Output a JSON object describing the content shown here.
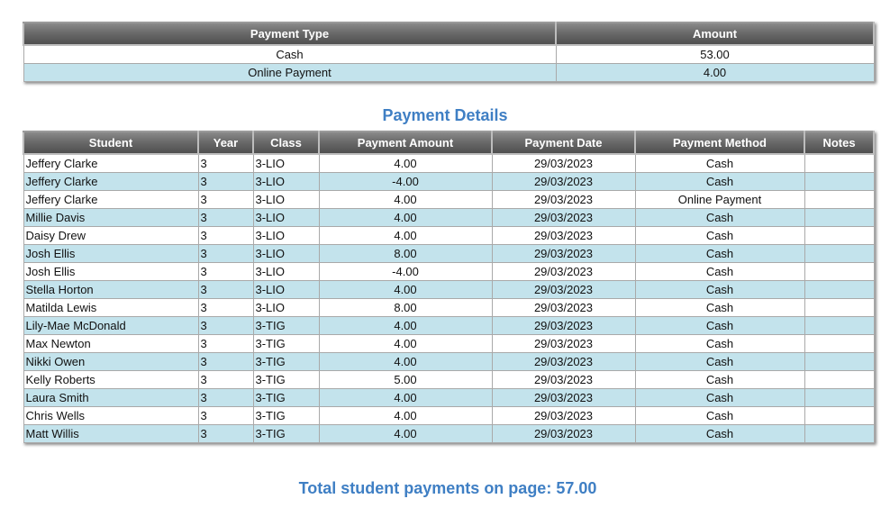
{
  "summary": {
    "headers": [
      "Payment Type",
      "Amount"
    ],
    "rows": [
      {
        "type": "Cash",
        "amount": "53.00"
      },
      {
        "type": "Online Payment",
        "amount": "4.00"
      }
    ]
  },
  "details": {
    "title": "Payment Details",
    "headers": [
      "Student",
      "Year",
      "Class",
      "Payment Amount",
      "Payment Date",
      "Payment Method",
      "Notes"
    ],
    "rows": [
      {
        "student": "Jeffery Clarke",
        "year": "3",
        "class": "3-LIO",
        "amount": "4.00",
        "date": "29/03/2023",
        "method": "Cash",
        "notes": ""
      },
      {
        "student": "Jeffery Clarke",
        "year": "3",
        "class": "3-LIO",
        "amount": "-4.00",
        "date": "29/03/2023",
        "method": "Cash",
        "notes": ""
      },
      {
        "student": "Jeffery Clarke",
        "year": "3",
        "class": "3-LIO",
        "amount": "4.00",
        "date": "29/03/2023",
        "method": "Online Payment",
        "notes": ""
      },
      {
        "student": "Millie Davis",
        "year": "3",
        "class": "3-LIO",
        "amount": "4.00",
        "date": "29/03/2023",
        "method": "Cash",
        "notes": ""
      },
      {
        "student": "Daisy Drew",
        "year": "3",
        "class": "3-LIO",
        "amount": "4.00",
        "date": "29/03/2023",
        "method": "Cash",
        "notes": ""
      },
      {
        "student": "Josh Ellis",
        "year": "3",
        "class": "3-LIO",
        "amount": "8.00",
        "date": "29/03/2023",
        "method": "Cash",
        "notes": ""
      },
      {
        "student": "Josh Ellis",
        "year": "3",
        "class": "3-LIO",
        "amount": "-4.00",
        "date": "29/03/2023",
        "method": "Cash",
        "notes": ""
      },
      {
        "student": "Stella Horton",
        "year": "3",
        "class": "3-LIO",
        "amount": "4.00",
        "date": "29/03/2023",
        "method": "Cash",
        "notes": ""
      },
      {
        "student": "Matilda Lewis",
        "year": "3",
        "class": "3-LIO",
        "amount": "8.00",
        "date": "29/03/2023",
        "method": "Cash",
        "notes": ""
      },
      {
        "student": "Lily-Mae McDonald",
        "year": "3",
        "class": "3-TIG",
        "amount": "4.00",
        "date": "29/03/2023",
        "method": "Cash",
        "notes": ""
      },
      {
        "student": "Max Newton",
        "year": "3",
        "class": "3-TIG",
        "amount": "4.00",
        "date": "29/03/2023",
        "method": "Cash",
        "notes": ""
      },
      {
        "student": "Nikki Owen",
        "year": "3",
        "class": "3-TIG",
        "amount": "4.00",
        "date": "29/03/2023",
        "method": "Cash",
        "notes": ""
      },
      {
        "student": "Kelly Roberts",
        "year": "3",
        "class": "3-TIG",
        "amount": "5.00",
        "date": "29/03/2023",
        "method": "Cash",
        "notes": ""
      },
      {
        "student": "Laura Smith",
        "year": "3",
        "class": "3-TIG",
        "amount": "4.00",
        "date": "29/03/2023",
        "method": "Cash",
        "notes": ""
      },
      {
        "student": "Chris Wells",
        "year": "3",
        "class": "3-TIG",
        "amount": "4.00",
        "date": "29/03/2023",
        "method": "Cash",
        "notes": ""
      },
      {
        "student": "Matt Willis",
        "year": "3",
        "class": "3-TIG",
        "amount": "4.00",
        "date": "29/03/2023",
        "method": "Cash",
        "notes": ""
      }
    ]
  },
  "total_text": "Total student payments on page: 57.00",
  "colors": {
    "heading": "#3f7fc4",
    "alt_row": "#c3e3ec",
    "header_bg": "#6a6a6a"
  }
}
